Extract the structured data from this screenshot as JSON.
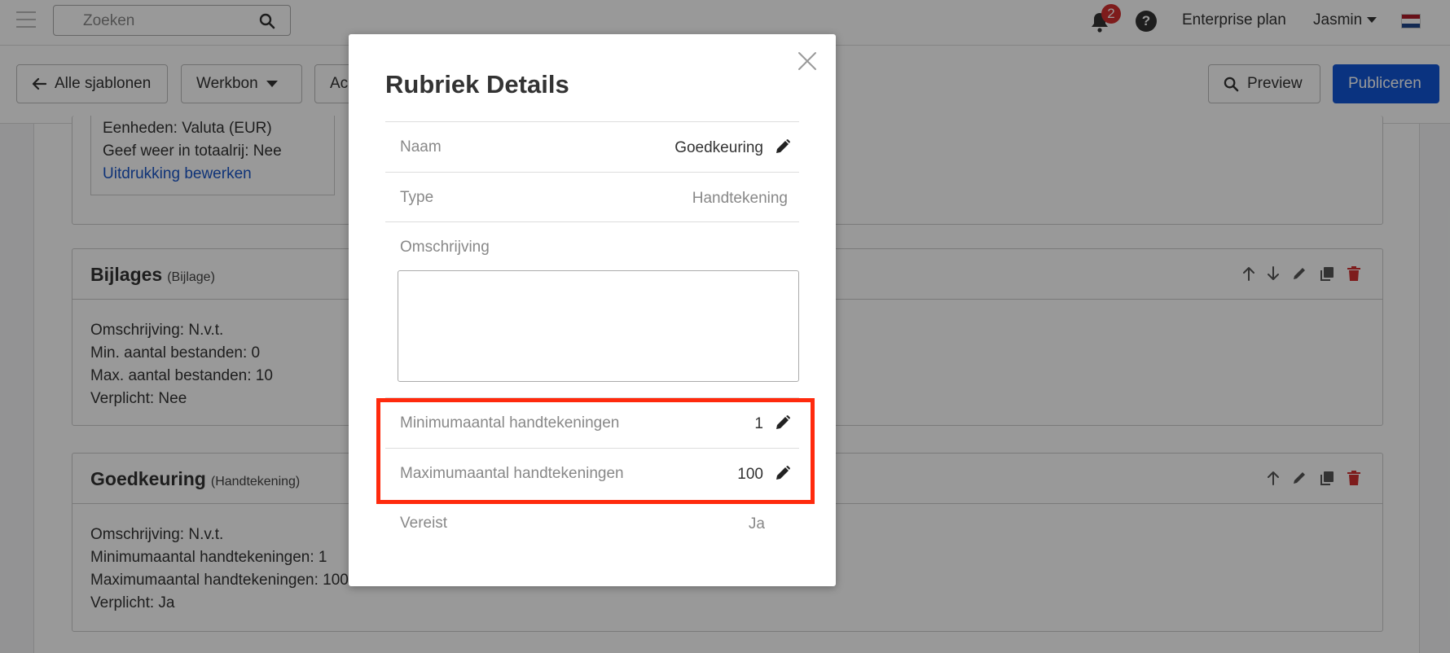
{
  "topbar": {
    "search_placeholder": "Zoeken",
    "notification_count": "2",
    "help_label": "?",
    "plan_label": "Enterprise plan",
    "user_name": "Jasmin"
  },
  "toolbar": {
    "back_label": "Alle sjablonen",
    "dropdown_label": "Werkbon",
    "partial_button_label": "Ac",
    "preview_label": "Preview",
    "publish_label": "Publiceren"
  },
  "cards": {
    "top_card_lines": [
      "Eenheden: Valuta (EUR)",
      "Geef weer in totaalrij: Nee"
    ],
    "top_card_link": "Uitdrukking bewerken",
    "attachments": {
      "title": "Bijlages",
      "type": "(Bijlage)",
      "lines": [
        "Omschrijving: N.v.t.",
        "Min. aantal bestanden: 0",
        "Max. aantal bestanden: 10",
        "Verplicht: Nee"
      ]
    },
    "approval": {
      "title": "Goedkeuring",
      "type": "(Handtekening)",
      "lines": [
        "Omschrijving: N.v.t.",
        "Minimumaantal handtekeningen: 1",
        "Maximumaantal handtekeningen: 100",
        "Verplicht: Ja"
      ]
    }
  },
  "modal": {
    "title": "Rubriek Details",
    "name_label": "Naam",
    "name_value": "Goedkeuring",
    "type_label": "Type",
    "type_value": "Handtekening",
    "description_label": "Omschrijving",
    "description_value": "",
    "min_label": "Minimumaantal handtekeningen",
    "min_value": "1",
    "max_label": "Maximumaantal handtekeningen",
    "max_value": "100",
    "required_label": "Vereist",
    "required_value": "Ja"
  },
  "colors": {
    "primary": "#1256d6",
    "danger": "#d32f2f",
    "highlight": "#ff2a0d",
    "link": "#1a56c8"
  }
}
